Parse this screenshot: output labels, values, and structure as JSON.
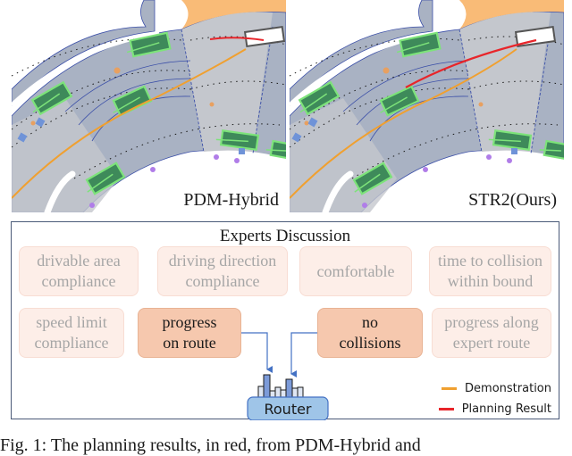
{
  "panels": [
    {
      "label": "PDM-Hybrid",
      "planning_variant": "short"
    },
    {
      "label": "STR2(Ours)",
      "planning_variant": "long"
    }
  ],
  "experts": {
    "title": "Experts Discussion",
    "items": [
      {
        "label": "drivable area\ncompliance",
        "state": "faded"
      },
      {
        "label": "driving direction\ncompliance",
        "state": "faded"
      },
      {
        "label": "comfortable",
        "state": "faded"
      },
      {
        "label": "time to collision\nwithin bound",
        "state": "faded"
      },
      {
        "label": "speed limit\ncompliance",
        "state": "faded"
      },
      {
        "label": "progress\non route",
        "state": "active"
      },
      {
        "label": "no\ncollisions",
        "state": "active"
      },
      {
        "label": "progress along\nexpert route",
        "state": "faded"
      }
    ]
  },
  "router": {
    "label": "Router"
  },
  "legend": [
    {
      "label": "Demonstration",
      "color": "#f0a030"
    },
    {
      "label": "Planning Result",
      "color": "#e8252a"
    }
  ],
  "colors": {
    "road": "#a9b2c3",
    "junction": "#c4c7cd",
    "lane_line": "#3b4fa8",
    "agent_fill": "#3e8a5a",
    "agent_outline": "#7de37a",
    "orange_area": "#f9bb77",
    "pedestrian": "#b07de8",
    "cyclist": "#6f93d8"
  },
  "caption": "Fig. 1: The planning results, in red, from PDM-Hybrid and"
}
